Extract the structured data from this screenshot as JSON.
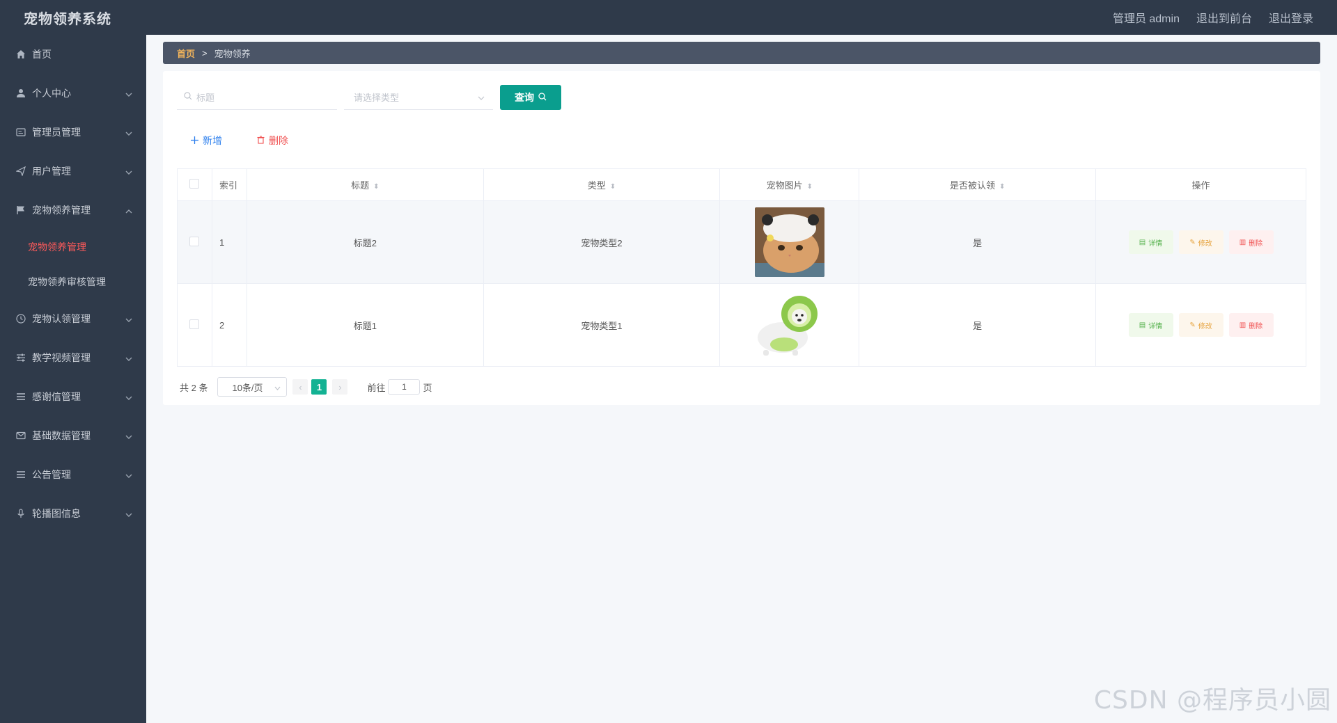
{
  "header": {
    "app_title": "宠物领养系统",
    "admin_label": "管理员 admin",
    "front_link": "退出到前台",
    "logout_link": "退出登录"
  },
  "sidebar": {
    "home": "首页",
    "personal": "个人中心",
    "admin_mgmt": "管理员管理",
    "user_mgmt": "用户管理",
    "adopt_mgmt": "宠物领养管理",
    "adopt_sub_1": "宠物领养管理",
    "adopt_sub_2": "宠物领养审核管理",
    "claim_mgmt": "宠物认领管理",
    "video_mgmt": "教学视频管理",
    "thanks_mgmt": "感谢信管理",
    "base_mgmt": "基础数据管理",
    "notice_mgmt": "公告管理",
    "carousel": "轮播图信息"
  },
  "breadcrumb": {
    "home": "首页",
    "sep": ">",
    "current": "宠物领养"
  },
  "search": {
    "title_placeholder": "标题",
    "type_placeholder": "请选择类型",
    "query_label": "查询"
  },
  "actions": {
    "add_label": "新增",
    "delete_label": "删除"
  },
  "table": {
    "headers": {
      "index": "索引",
      "title": "标题",
      "type": "类型",
      "image": "宠物图片",
      "claimed": "是否被认领",
      "ops": "操作"
    },
    "rows": [
      {
        "index": "1",
        "title": "标题2",
        "type": "宠物类型2",
        "claimed": "是"
      },
      {
        "index": "2",
        "title": "标题1",
        "type": "宠物类型1",
        "claimed": "是"
      }
    ],
    "op_detail": "详情",
    "op_edit": "修改",
    "op_delete": "删除"
  },
  "pager": {
    "total": "共 2 条",
    "page_size": "10条/页",
    "current_page": "1",
    "goto_prefix": "前往",
    "goto_value": "1",
    "goto_suffix": "页"
  },
  "watermark": "CSDN @程序员小圆",
  "colors": {
    "topbar": "#2f3a4a",
    "accent": "#0a9e8e",
    "active_menu": "#ff5a5a",
    "breadcrumb_home": "#f0b35b"
  }
}
